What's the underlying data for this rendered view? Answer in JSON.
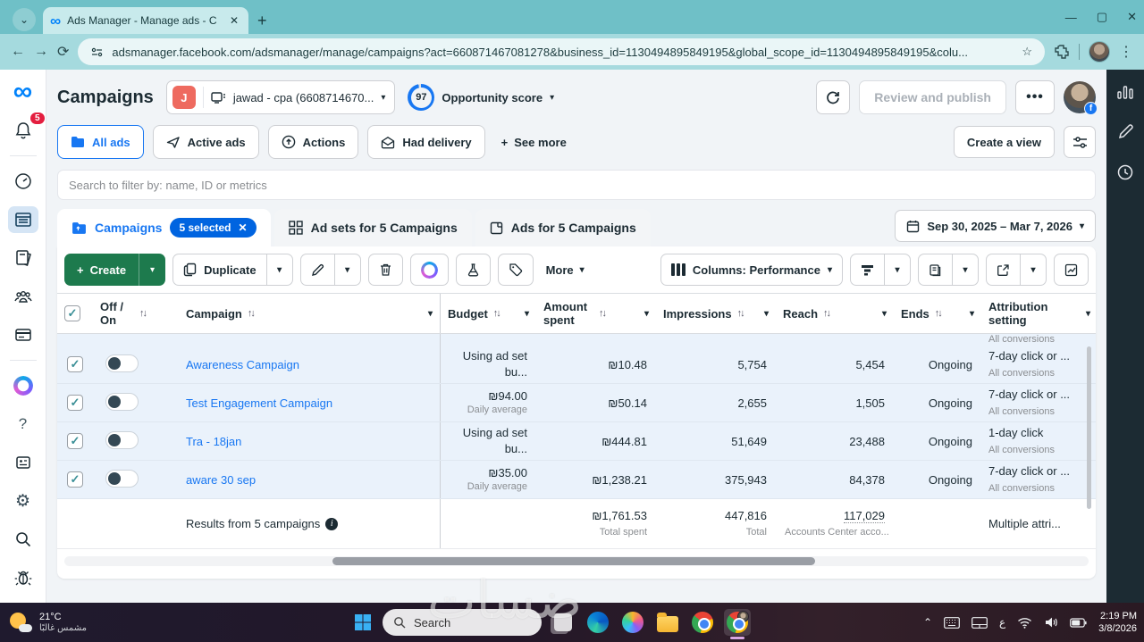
{
  "icons": {
    "dropdown": "▾",
    "sort": "↑↓",
    "close": "✕",
    "plus": "+",
    "star": "☆",
    "menu_dots": "⋮",
    "back": "←",
    "forward": "→",
    "minimize": "—",
    "maximize": "▢",
    "chevron_small": "⌄",
    "up_caret": "⌃",
    "question": "?",
    "gear": "⚙",
    "infinity": "∞",
    "arrow_up": "↑",
    "info": "i"
  },
  "browser": {
    "tab_title": "Ads Manager - Manage ads - C",
    "url": "adsmanager.facebook.com/adsmanager/manage/campaigns?act=660871467081278&business_id=1130494895849195&global_scope_id=1130494895849195&colu..."
  },
  "header": {
    "title": "Campaigns",
    "account_initial": "J",
    "account_name": "jawad - cpa (6608714670...",
    "score_value": "97",
    "score_label": "Opportunity score",
    "review_button": "Review and publish",
    "more_button": "•••"
  },
  "notifications_badge": "5",
  "filters": {
    "all_ads": "All ads",
    "active_ads": "Active ads",
    "actions": "Actions",
    "had_delivery": "Had delivery",
    "see_more": "See more",
    "create_view": "Create a view"
  },
  "search": {
    "placeholder": "Search to filter by: name, ID or metrics"
  },
  "level_tabs": {
    "campaigns": "Campaigns",
    "selected_badge": "5 selected",
    "adsets": "Ad sets for 5 Campaigns",
    "ads": "Ads for 5 Campaigns",
    "date_range": "Sep 30, 2025 – Mar 7, 2026"
  },
  "toolbar": {
    "create_label": "Create",
    "duplicate_label": "Duplicate",
    "more_label": "More",
    "columns_label": "Columns: Performance"
  },
  "table": {
    "headers": {
      "off_on": "Off / On",
      "campaign": "Campaign",
      "budget": "Budget",
      "amount_spent": "Amount spent",
      "impressions": "Impressions",
      "reach": "Reach",
      "ends": "Ends",
      "attribution": "Attribution setting"
    },
    "clipped_row_attribution": "All conversions",
    "rows": [
      {
        "name": "Awareness Campaign",
        "budget": "Using ad set bu...",
        "budget_sub": "",
        "spent": "₪10.48",
        "impressions": "5,754",
        "reach": "5,454",
        "ends": "Ongoing",
        "attribution": "7-day click or ...",
        "attribution_sub": "All conversions"
      },
      {
        "name": "Test Engagement Campaign",
        "budget": "₪94.00",
        "budget_sub": "Daily average",
        "spent": "₪50.14",
        "impressions": "2,655",
        "reach": "1,505",
        "ends": "Ongoing",
        "attribution": "7-day click or ...",
        "attribution_sub": "All conversions"
      },
      {
        "name": "Tra - 18jan",
        "budget": "Using ad set bu...",
        "budget_sub": "",
        "spent": "₪444.81",
        "impressions": "51,649",
        "reach": "23,488",
        "ends": "Ongoing",
        "attribution": "1-day click",
        "attribution_sub": "All conversions"
      },
      {
        "name": "aware 30 sep",
        "budget": "₪35.00",
        "budget_sub": "Daily average",
        "spent": "₪1,238.21",
        "impressions": "375,943",
        "reach": "84,378",
        "ends": "Ongoing",
        "attribution": "7-day click or ...",
        "attribution_sub": "All conversions"
      }
    ],
    "results": {
      "label": "Results from 5 campaigns",
      "spent": "₪1,761.53",
      "spent_sub": "Total spent",
      "impressions": "447,816",
      "impressions_sub": "Total",
      "reach": "117,029",
      "reach_sub": "Accounts Center acco...",
      "attribution": "Multiple attri..."
    }
  },
  "taskbar": {
    "weather_temp": "21°C",
    "weather_desc": "مشمس غالبًا",
    "search_label": "Search",
    "language": "ع",
    "time": "2:19 PM",
    "date": "3/8/2026"
  },
  "watermark": "ضسات"
}
